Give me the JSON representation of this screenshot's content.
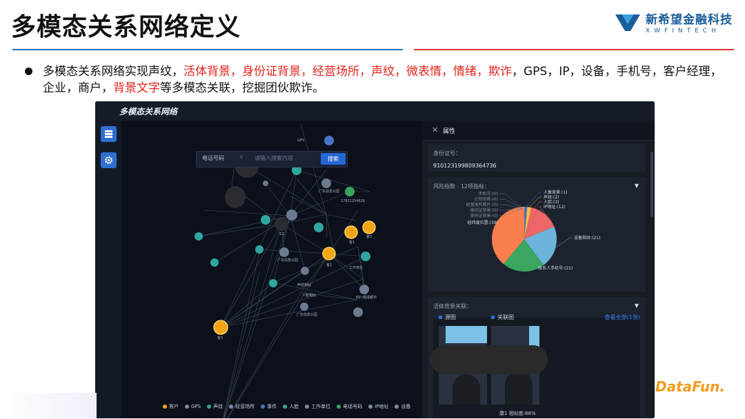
{
  "slide": {
    "title": "多模态关系网络定义",
    "brand_cn": "新希望金融科技",
    "brand_en": "XWFINTECH",
    "bullet": {
      "p1": "多模态关系网络实现声纹，",
      "h1": "活体背景，身份证背景，经营场所，声纹，微表情，情绪，欺诈",
      "p2": "，GPS，IP，设备，手机号，客户经理，企业，商户，",
      "h2": "背景文字",
      "p3": "等多模态关联，挖掘团伙欺诈。"
    },
    "footer_logo": "DataFun."
  },
  "app": {
    "title": "多模态关系网络",
    "search": {
      "select_value": "电话号码",
      "placeholder": "请输入搜索内容",
      "button": "搜索"
    },
    "legend": [
      {
        "label": "客户",
        "color": "#f2a516"
      },
      {
        "label": "GPS",
        "color": "#7c8aa6"
      },
      {
        "label": "声纹",
        "color": "#2fa7a0"
      },
      {
        "label": "经营场所",
        "color": "#7c8aa6"
      },
      {
        "label": "事件",
        "color": "#4a73c9"
      },
      {
        "label": "人脸",
        "color": "#2fa7a0"
      },
      {
        "label": "工作单位",
        "color": "#7c8aa6"
      },
      {
        "label": "电话号码",
        "color": "#3aa35a"
      },
      {
        "label": "IP地址",
        "color": "#7c8aa6"
      },
      {
        "label": "设备",
        "color": "#7c8aa6"
      }
    ],
    "graph_labels": {
      "n1": "工2",
      "n2": "客1",
      "n3": "客1",
      "n4": "客2",
      "n5": "客3",
      "phone": "17621254616",
      "place1": "广东信息公园",
      "place2": "广东信息公园",
      "place3": "四川省成都市",
      "place4": "广东信息公园",
      "edge1": "人脸相似",
      "edge2": "声纹相似",
      "edge3": "工作单位",
      "edge4": "GPS"
    }
  },
  "panel": {
    "title": "属性",
    "id_label": "身份证号：",
    "id_value": "910123199809364736",
    "risk_label": "风险指数 - 12项指标：",
    "pie_labels": [
      "手机号:(0)",
      "公司名称:(0)",
      "经营场所照片:(0)",
      "身份证背景:(0)",
      "身份证背景:(0)",
      "经纬度位置:(39)",
      "人像背景:(1)",
      "声纹:(2)",
      "人脸:(3)",
      "IP地址:(12)",
      "设备指纹:(21)",
      "联系人手机号:(21)"
    ],
    "live_label": "活体背景关联：",
    "tab_source": "源图",
    "tab_related": "关联图",
    "view_all": "查看全部(1张)",
    "similarity": "康1 相似度:88%"
  },
  "chart_data": {
    "type": "pie",
    "title": "风险指数 - 12项指标：",
    "categories": [
      "手机号",
      "公司名称",
      "经营场所照片",
      "身份证背景",
      "身份证背景",
      "经纬度位置",
      "人像背景",
      "声纹",
      "人脸",
      "IP地址",
      "设备指纹",
      "联系人手机号"
    ],
    "values": [
      0,
      0,
      0,
      0,
      0,
      39,
      1,
      2,
      3,
      12,
      21,
      21
    ],
    "colors": [
      "#4a73c9",
      "#4a73c9",
      "#4a73c9",
      "#4a73c9",
      "#4a73c9",
      "#fa7f4f",
      "#4a73c9",
      "#f5c242",
      "#ee6666",
      "#ee6666",
      "#6cb4dc",
      "#3aa65f"
    ]
  }
}
